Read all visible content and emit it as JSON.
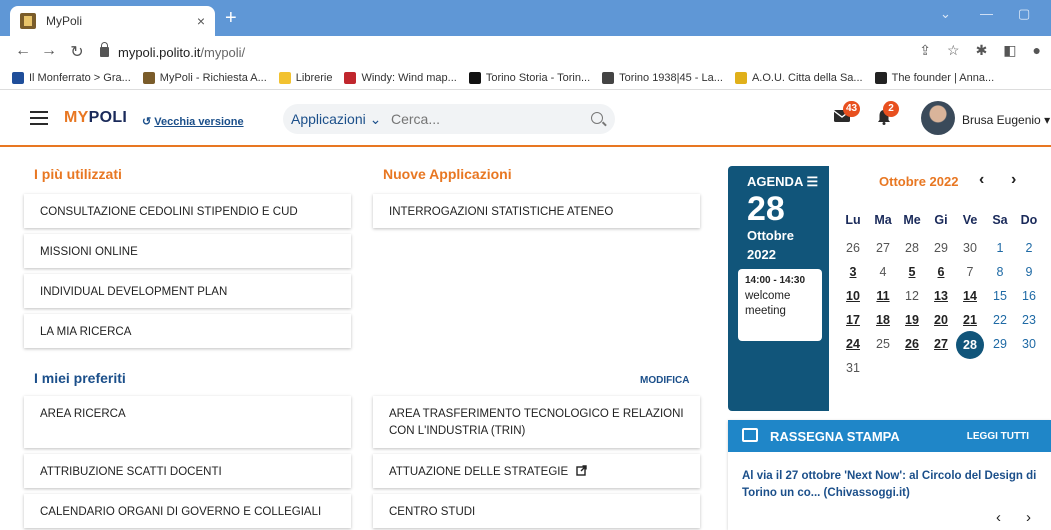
{
  "browser": {
    "tab_title": "MyPoli",
    "tab_close": "×",
    "new_tab": "+",
    "url_host": "mypoli.polito.it",
    "url_path": "/mypoli/",
    "bookmarks": [
      {
        "label": "Il Monferrato > Gra...",
        "color": "#1f4e9a"
      },
      {
        "label": "MyPoli - Richiesta A...",
        "color": "#7a5c2a"
      },
      {
        "label": "Librerie",
        "color": "#f2c230"
      },
      {
        "label": "Windy: Wind map...",
        "color": "#c0262d"
      },
      {
        "label": "Torino Storia - Torin...",
        "color": "#111111"
      },
      {
        "label": "Torino 1938|45 - La...",
        "color": "#444444"
      },
      {
        "label": "A.O.U. Citta della Sa...",
        "color": "#e0b01a"
      },
      {
        "label": "The founder | Anna...",
        "color": "#222222"
      }
    ]
  },
  "header": {
    "logo_my": "MY",
    "logo_poli": "POLI",
    "old_version": "Vecchia versione",
    "search_select": "Applicazioni",
    "search_placeholder": "Cerca...",
    "mail_badge": "43",
    "bell_badge": "2",
    "user_name": "Brusa Eugenio"
  },
  "main": {
    "most_used_title": "I più utilizzati",
    "most_used": [
      "CONSULTAZIONE CEDOLINI STIPENDIO E CUD",
      "MISSIONI ONLINE",
      "INDIVIDUAL DEVELOPMENT PLAN",
      "LA MIA RICERCA"
    ],
    "new_apps_title": "Nuove Applicazioni",
    "new_apps": [
      "INTERROGAZIONI STATISTICHE ATENEO"
    ],
    "favorites_title": "I miei preferiti",
    "modify_label": "MODIFICA",
    "favorites_left": [
      "AREA RICERCA",
      "ATTRIBUZIONE SCATTI DOCENTI",
      "CALENDARIO ORGANI DI GOVERNO E COLLEGIALI"
    ],
    "favorites_right": [
      "AREA TRASFERIMENTO TECNOLOGICO E RELAZIONI CON L'INDUSTRIA (TRIN)",
      "ATTUAZIONE DELLE STRATEGIE",
      "CENTRO STUDI"
    ]
  },
  "agenda": {
    "title": "AGENDA",
    "day": "28",
    "month": "Ottobre",
    "year": "2022",
    "event_time": "14:00 - 14:30",
    "event_name": "welcome meeting"
  },
  "calendar": {
    "month_label": "Ottobre 2022",
    "weekdays": [
      "Lu",
      "Ma",
      "Me",
      "Gi",
      "Ve",
      "Sa",
      "Do"
    ],
    "days": [
      "26",
      "27",
      "28",
      "29",
      "30",
      "1",
      "2",
      "3",
      "4",
      "5",
      "6",
      "7",
      "8",
      "9",
      "10",
      "11",
      "12",
      "13",
      "14",
      "15",
      "16",
      "17",
      "18",
      "19",
      "20",
      "21",
      "22",
      "23",
      "24",
      "25",
      "26",
      "27",
      "28",
      "29",
      "30",
      "31"
    ]
  },
  "rassegna": {
    "title": "RASSEGNA STAMPA",
    "read_all": "LEGGI TUTTI",
    "headline": "Al via il 27 ottobre 'Next Now': al Circolo del Design di Torino un co... (Chivassoggi.it)"
  },
  "colors": {
    "accent": "#e87722",
    "agenda_bg": "#11557a",
    "rassegna_bg": "#1f86c8",
    "badge": "#e8501f"
  }
}
